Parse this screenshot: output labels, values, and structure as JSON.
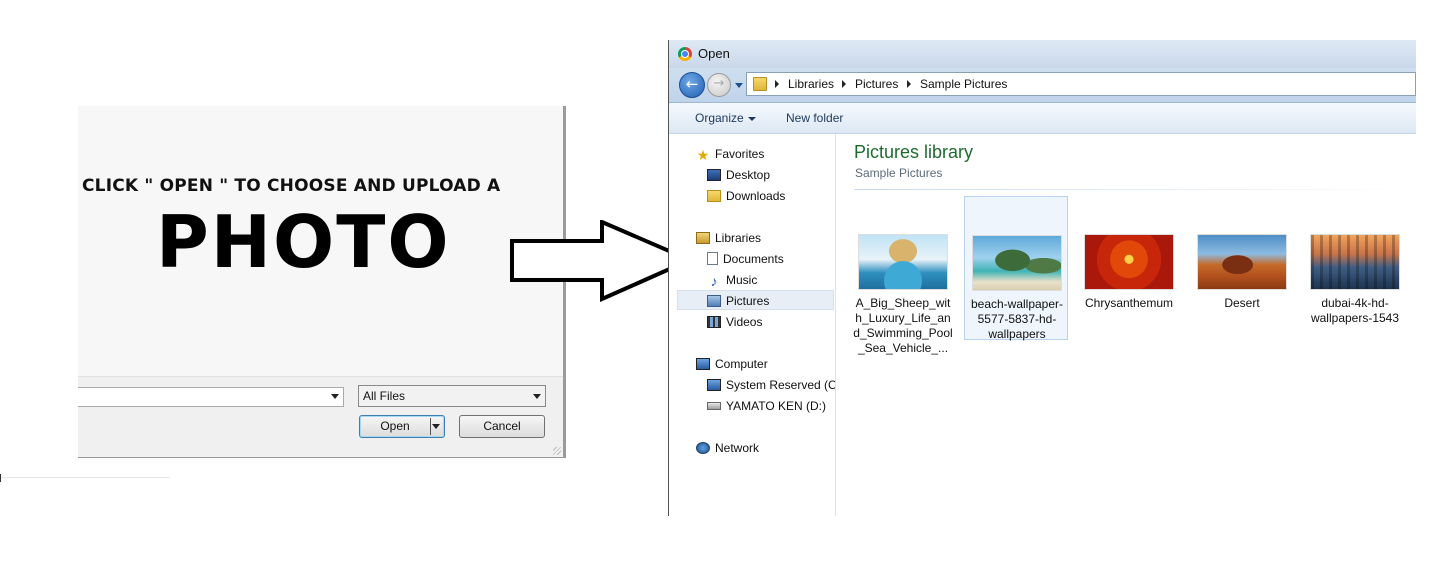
{
  "left": {
    "instruction_line": "CLICK \" OPEN \" TO CHOOSE AND UPLOAD A",
    "instruction_big": "PHOTO",
    "file_name_value": "",
    "file_type": "All Files",
    "open_label": "Open",
    "cancel_label": "Cancel"
  },
  "dialog": {
    "title": "Open",
    "breadcrumbs": [
      "Libraries",
      "Pictures",
      "Sample Pictures"
    ],
    "toolbar": {
      "organize": "Organize",
      "new_folder": "New folder"
    },
    "nav": {
      "favorites": "Favorites",
      "desktop": "Desktop",
      "downloads": "Downloads",
      "libraries": "Libraries",
      "documents": "Documents",
      "music": "Music",
      "pictures": "Pictures",
      "videos": "Videos",
      "computer": "Computer",
      "system_reserved": "System Reserved (C:",
      "drive_d": "YAMATO KEN (D:)",
      "network": "Network"
    },
    "content": {
      "title": "Pictures library",
      "subtitle": "Sample Pictures",
      "files": [
        {
          "name": "A_Big_Sheep_with_Luxury_Life_and_Swimming_Pool_Sea_Vehicle_...",
          "selected": false
        },
        {
          "name": "beach-wallpaper-5577-5837-hd-wallpapers",
          "selected": true
        },
        {
          "name": "Chrysanthemum",
          "selected": false
        },
        {
          "name": "Desert",
          "selected": false
        },
        {
          "name": "dubai-4k-hd-wallpapers-1543",
          "selected": false
        }
      ]
    }
  },
  "icons": [
    "chrome-icon",
    "back-arrow-icon",
    "forward-arrow-icon",
    "folder-icon",
    "star-icon",
    "desktop-icon",
    "downloads-icon",
    "library-icon",
    "document-icon",
    "music-icon",
    "pictures-icon",
    "video-icon",
    "computer-icon",
    "drive-icon",
    "network-icon",
    "right-arrow-icon"
  ],
  "colors": {
    "library_title": "#1e6b2e",
    "selection": "#eef5fd",
    "open_button_border": "#3c7fb1"
  }
}
